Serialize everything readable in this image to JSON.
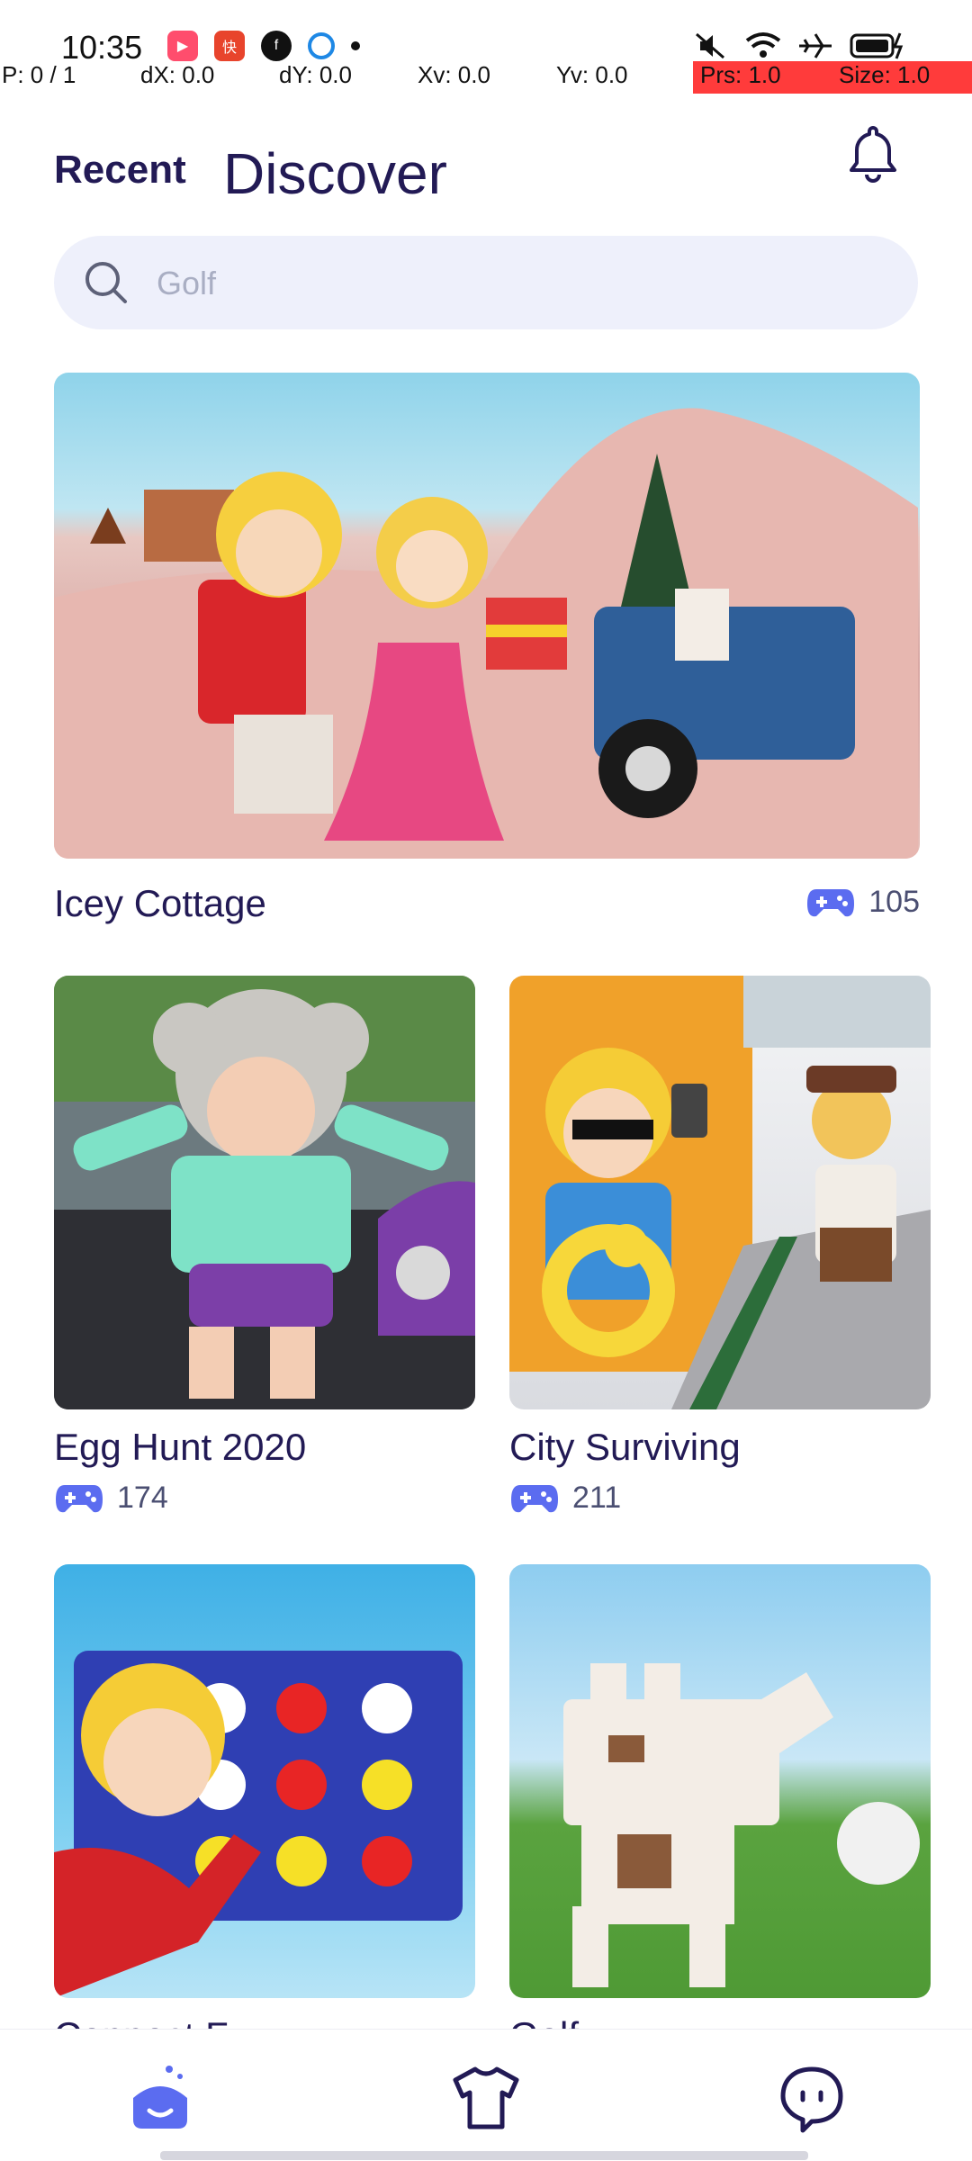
{
  "status_bar": {
    "time": "10:35",
    "app_icons": [
      "video-app-icon",
      "kuaibao-app-icon",
      "facebook-icon",
      "browser-icon"
    ],
    "system_icons": [
      "mute-icon",
      "wifi-icon",
      "airplane-icon",
      "battery-icon"
    ]
  },
  "pointer_overlay": {
    "p": "P: 0 / 1",
    "dx": "dX: 0.0",
    "dy": "dY: 0.0",
    "xv": "Xv: 0.0",
    "yv": "Yv: 0.0",
    "prs": "Prs: 1.0",
    "size": "Size: 1.0"
  },
  "header": {
    "recent_label": "Recent",
    "discover_label": "Discover",
    "bell_icon": "bell-icon"
  },
  "search": {
    "placeholder": "Golf",
    "icon": "search-icon"
  },
  "games": [
    {
      "title": "Icey Cottage",
      "plays": "105"
    },
    {
      "title": "Egg Hunt 2020",
      "plays": "174"
    },
    {
      "title": "City Surviving",
      "plays": "211"
    },
    {
      "title": "Connect F...",
      "plays": ""
    },
    {
      "title": "Golf",
      "plays": ""
    }
  ],
  "bottom_nav": {
    "items": [
      "home-icon",
      "shirt-icon",
      "chat-icon"
    ]
  },
  "colors": {
    "accent": "#5b6cf0",
    "text_dark": "#221a55",
    "search_bg": "#eef0fb"
  }
}
